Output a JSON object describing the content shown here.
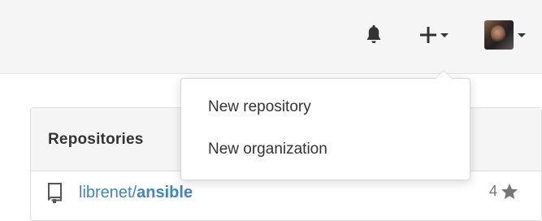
{
  "header": {
    "icons": {
      "notifications": "bell-icon",
      "create": "plus-icon",
      "avatar": "user-avatar"
    }
  },
  "create_menu": {
    "items": [
      {
        "label": "New repository"
      },
      {
        "label": "New organization"
      }
    ]
  },
  "repositories": {
    "title": "Repositories",
    "items": [
      {
        "owner": "librenet/",
        "name": "ansible",
        "stars": "4",
        "icon": "repo-icon"
      }
    ]
  },
  "colors": {
    "link": "#4183c4",
    "header_bg": "#f5f5f5",
    "text": "#333333",
    "muted": "#777777"
  }
}
